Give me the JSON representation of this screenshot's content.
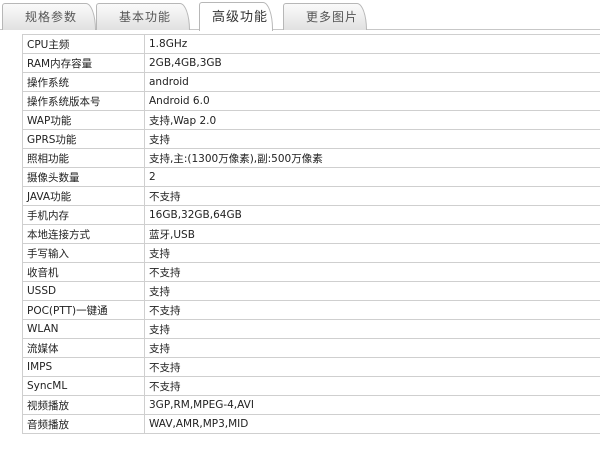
{
  "tabs": [
    {
      "label": "规格参数",
      "active": false
    },
    {
      "label": "基本功能",
      "active": false
    },
    {
      "label": "高级功能",
      "active": true
    },
    {
      "label": "更多图片",
      "active": false
    }
  ],
  "rows": [
    {
      "key": "CPU主频",
      "value": "1.8GHz"
    },
    {
      "key": "RAM内存容量",
      "value": "2GB,4GB,3GB"
    },
    {
      "key": "操作系统",
      "value": "android"
    },
    {
      "key": "操作系统版本号",
      "value": "Android 6.0"
    },
    {
      "key": "WAP功能",
      "value": "支持,Wap 2.0"
    },
    {
      "key": "GPRS功能",
      "value": "支持"
    },
    {
      "key": "照相功能",
      "value": "支持,主:(1300万像素),副:500万像素"
    },
    {
      "key": "摄像头数量",
      "value": "2"
    },
    {
      "key": "JAVA功能",
      "value": "不支持"
    },
    {
      "key": "手机内存",
      "value": "16GB,32GB,64GB"
    },
    {
      "key": "本地连接方式",
      "value": "蓝牙,USB"
    },
    {
      "key": "手写输入",
      "value": "支持"
    },
    {
      "key": "收音机",
      "value": "不支持"
    },
    {
      "key": "USSD",
      "value": "支持"
    },
    {
      "key": "POC(PTT)一键通",
      "value": "不支持"
    },
    {
      "key": "WLAN",
      "value": "支持"
    },
    {
      "key": "流媒体",
      "value": "支持"
    },
    {
      "key": "IMPS",
      "value": "不支持"
    },
    {
      "key": "SyncML",
      "value": "不支持"
    },
    {
      "key": "视频播放",
      "value": "3GP,RM,MPEG-4,AVI"
    },
    {
      "key": "音频播放",
      "value": "WAV,AMR,MP3,MID"
    }
  ]
}
